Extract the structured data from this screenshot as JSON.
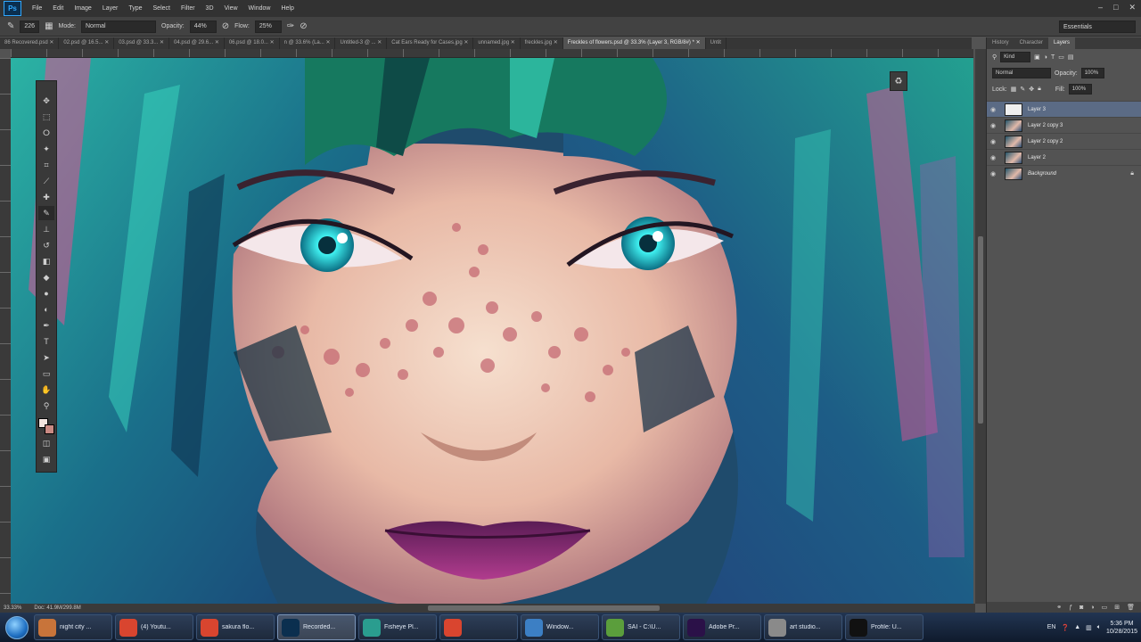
{
  "app": {
    "logo": "Ps"
  },
  "menu": [
    "File",
    "Edit",
    "Image",
    "Layer",
    "Type",
    "Select",
    "Filter",
    "3D",
    "View",
    "Window",
    "Help"
  ],
  "window_controls": [
    "–",
    "□",
    "✕"
  ],
  "options": {
    "brush_size": "226",
    "mode_label": "Mode:",
    "mode_value": "Normal",
    "opacity_label": "Opacity:",
    "opacity_value": "44%",
    "flow_label": "Flow:",
    "flow_value": "25%",
    "workspace": "Essentials"
  },
  "doc_tabs": [
    "86 Recovered.psd ✕",
    "02.psd @ 16.5... ✕",
    "03.psd @ 33.3... ✕",
    "04.psd @ 29.6... ✕",
    "06.psd @ 18.0... ✕",
    "n @ 33.6% (La... ✕",
    "Untitled-3 @ ... ✕",
    "Cat Ears Ready for Cases.jpg ✕",
    "unnamed.jpg ✕",
    "freckles.jpg ✕",
    "Freckles of flowers.psd @ 33.3% (Layer 3, RGB/8#) * ✕",
    "Untit"
  ],
  "status": {
    "zoom": "33.33%",
    "doc": "Doc: 41.9M/299.8M"
  },
  "panel": {
    "tabs": [
      "History",
      "Character",
      "Layers"
    ],
    "filter_kind": "Kind",
    "blend_mode": "Normal",
    "opacity_label": "Opacity:",
    "opacity_value": "100%",
    "lock_label": "Lock:",
    "fill_label": "Fill:",
    "fill_value": "100%",
    "layers": [
      {
        "name": "Layer 3",
        "active": true
      },
      {
        "name": "Layer 2 copy 3",
        "active": false
      },
      {
        "name": "Layer 2 copy 2",
        "active": false
      },
      {
        "name": "Layer 2",
        "active": false
      },
      {
        "name": "Background",
        "active": false
      }
    ]
  },
  "taskbar": {
    "items": [
      {
        "icon": "pencil-app-icon",
        "label": "night city ...",
        "color": "#c8743a"
      },
      {
        "icon": "chrome-icon",
        "label": "(4) Youtu...",
        "color": "#d9452f"
      },
      {
        "icon": "chrome-icon",
        "label": "sakura flo...",
        "color": "#d9452f"
      },
      {
        "icon": "photoshop-icon",
        "label": "Recorded...",
        "color": "#0b2f4f"
      },
      {
        "icon": "fisheye-icon",
        "label": "Fisheye Pl...",
        "color": "#2a9d8f"
      },
      {
        "icon": "chrome-icon",
        "label": "",
        "color": "#d9452f"
      },
      {
        "icon": "window-icon",
        "label": "Window...",
        "color": "#3c7fc4"
      },
      {
        "icon": "sai-icon",
        "label": "SAI - C:\\U...",
        "color": "#5b9e3c"
      },
      {
        "icon": "premiere-icon",
        "label": "Adobe Pr...",
        "color": "#2b1148"
      },
      {
        "icon": "art-studio-icon",
        "label": "art studio...",
        "color": "#8a8a8a"
      },
      {
        "icon": "obs-icon",
        "label": "Profile: U...",
        "color": "#111111"
      }
    ],
    "lang": "EN",
    "time": "5:36 PM",
    "date": "10/28/2015"
  }
}
